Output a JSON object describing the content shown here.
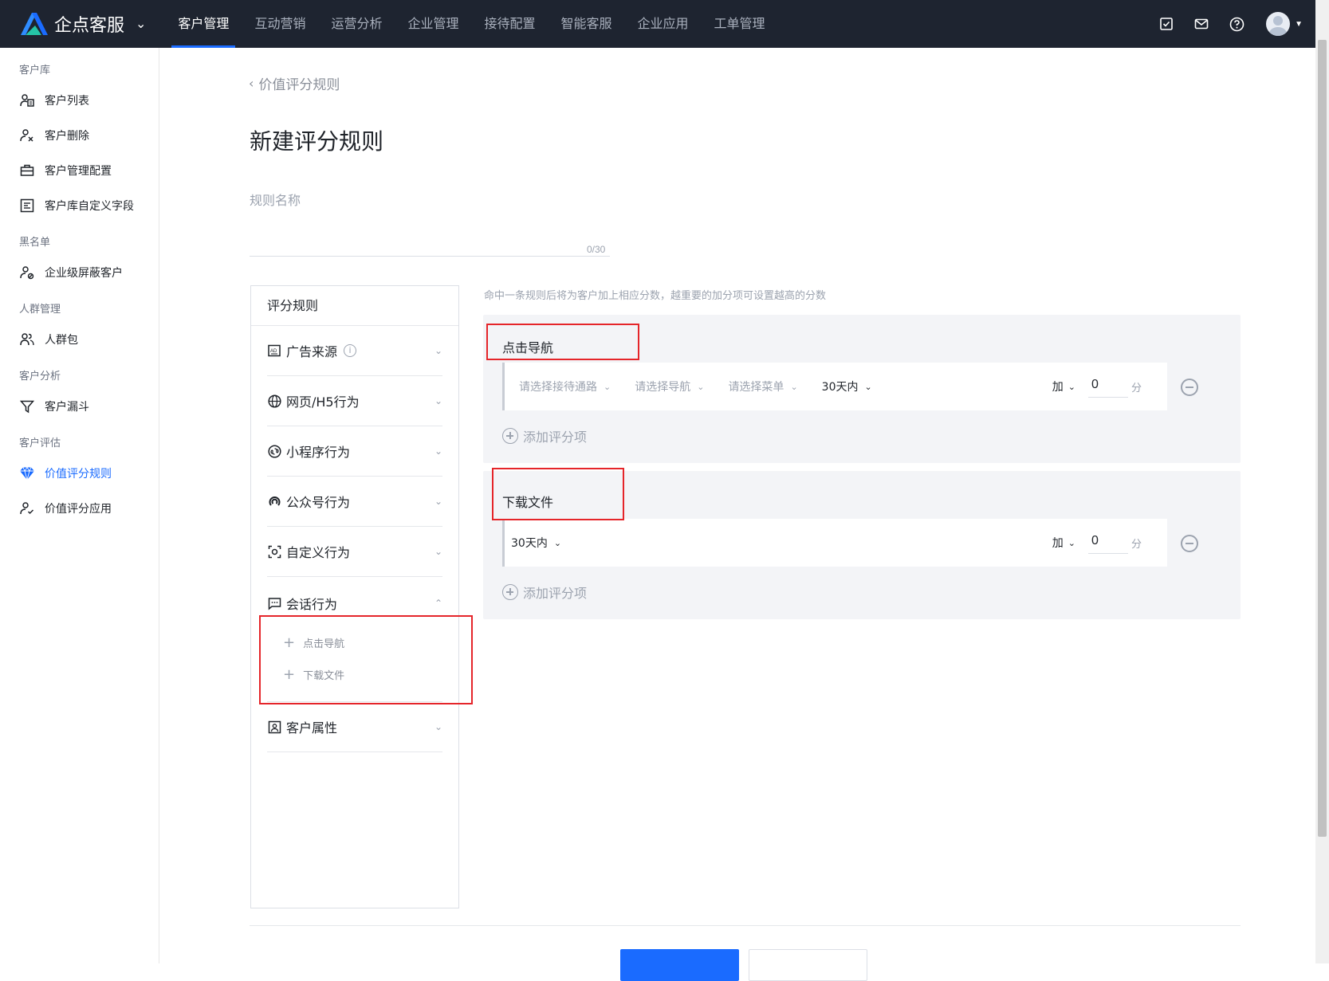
{
  "app": {
    "brand_name": "企点客服",
    "nav": [
      "客户管理",
      "互动营销",
      "运营分析",
      "企业管理",
      "接待配置",
      "智能客服",
      "企业应用",
      "工单管理"
    ],
    "active_nav": 0,
    "top_icons": [
      "task-check-icon",
      "mail-icon",
      "help-icon"
    ]
  },
  "sidebar": {
    "groups": [
      {
        "title": "客户库",
        "items": [
          {
            "label": "客户列表",
            "icon": "customer-list-icon"
          },
          {
            "label": "客户删除",
            "icon": "user-remove-icon"
          },
          {
            "label": "客户管理配置",
            "icon": "briefcase-icon"
          },
          {
            "label": "客户库自定义字段",
            "icon": "form-fields-icon"
          }
        ]
      },
      {
        "title": "黑名单",
        "items": [
          {
            "label": "企业级屏蔽客户",
            "icon": "user-block-icon"
          }
        ]
      },
      {
        "title": "人群管理",
        "items": [
          {
            "label": "人群包",
            "icon": "users-group-icon"
          }
        ]
      },
      {
        "title": "客户分析",
        "items": [
          {
            "label": "客户漏斗",
            "icon": "funnel-icon"
          }
        ]
      },
      {
        "title": "客户评估",
        "items": [
          {
            "label": "价值评分规则",
            "icon": "diamond-icon",
            "active": true
          },
          {
            "label": "价值评分应用",
            "icon": "user-check-icon"
          }
        ]
      }
    ]
  },
  "page": {
    "breadcrumb": "价值评分规则",
    "title": "新建评分规则",
    "name_label": "规则名称",
    "name_value": "",
    "char_count": "0/30",
    "hint": "命中一条规则后将为客户加上相应分数，越重要的加分项可设置越高的分数"
  },
  "rules_panel": {
    "title": "评分规则",
    "categories": [
      {
        "label": "广告来源",
        "icon": "ad-icon",
        "info": true
      },
      {
        "label": "网页/H5行为",
        "icon": "globe-icon"
      },
      {
        "label": "小程序行为",
        "icon": "miniprogram-icon"
      },
      {
        "label": "公众号行为",
        "icon": "official-account-icon"
      },
      {
        "label": "自定义行为",
        "icon": "custom-behavior-icon"
      },
      {
        "label": "会话行为",
        "icon": "chat-icon",
        "open": true,
        "subitems": [
          "点击导航",
          "下载文件"
        ]
      },
      {
        "label": "客户属性",
        "icon": "profile-card-icon"
      }
    ]
  },
  "rule_cards": [
    {
      "name": "点击导航",
      "selects": [
        "请选择接待通路",
        "请选择导航",
        "请选择菜单"
      ],
      "period": "30天内",
      "op": "加",
      "score": "0",
      "unit": "分",
      "add_label": "添加评分项"
    },
    {
      "name": "下载文件",
      "selects": [],
      "period": "30天内",
      "op": "加",
      "score": "0",
      "unit": "分",
      "add_label": "添加评分项"
    }
  ],
  "footer": {
    "confirm": "",
    "cancel": ""
  },
  "colors": {
    "accent": "#1a6bff",
    "topbar": "#1e2430",
    "highlight": "#e5252a"
  }
}
